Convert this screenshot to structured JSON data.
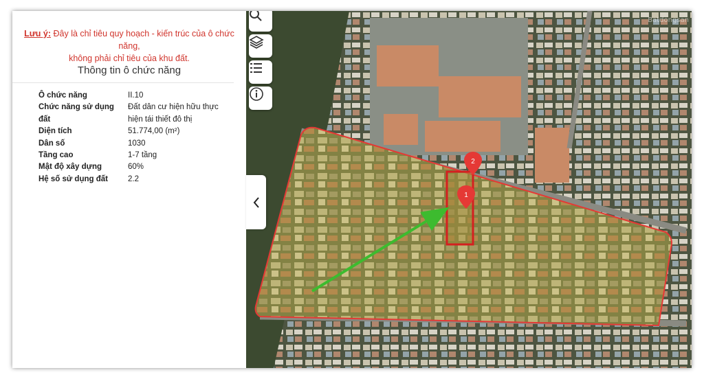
{
  "note": {
    "tag": "Lưu ý:",
    "line1": "Đây là chỉ tiêu quy hoạch - kiến trúc của ô chức năng,",
    "line2": "không phải chỉ tiêu của khu đất."
  },
  "section_title": "Thông tin ô chức năng",
  "info": [
    {
      "key": "Ô chức năng",
      "value": "II.10"
    },
    {
      "key": "Chức năng sử dụng",
      "value": "Đất dân cư hiện hữu thực"
    },
    {
      "key": "đất",
      "value": "hiện tái thiết đô thị"
    },
    {
      "key": "Diện tích",
      "value": "51.774,00 (m²)"
    },
    {
      "key": "Dân số",
      "value": "1030"
    },
    {
      "key": "Tầng cao",
      "value": "1-7 tầng"
    },
    {
      "key": "Mật độ xây dựng",
      "value": "60%"
    },
    {
      "key": "Hệ số sử dụng đất",
      "value": "2.2"
    }
  ],
  "map": {
    "buttons": [
      "search-icon",
      "layers-icon",
      "legend-list-icon",
      "info-icon"
    ],
    "markers": [
      "1",
      "2"
    ],
    "watermark": "Batdongsan",
    "colors": {
      "zone": "#e53935",
      "arrow": "#3dbb2f",
      "zone_fill": "#b5a84c",
      "marker": "#e53935"
    }
  }
}
